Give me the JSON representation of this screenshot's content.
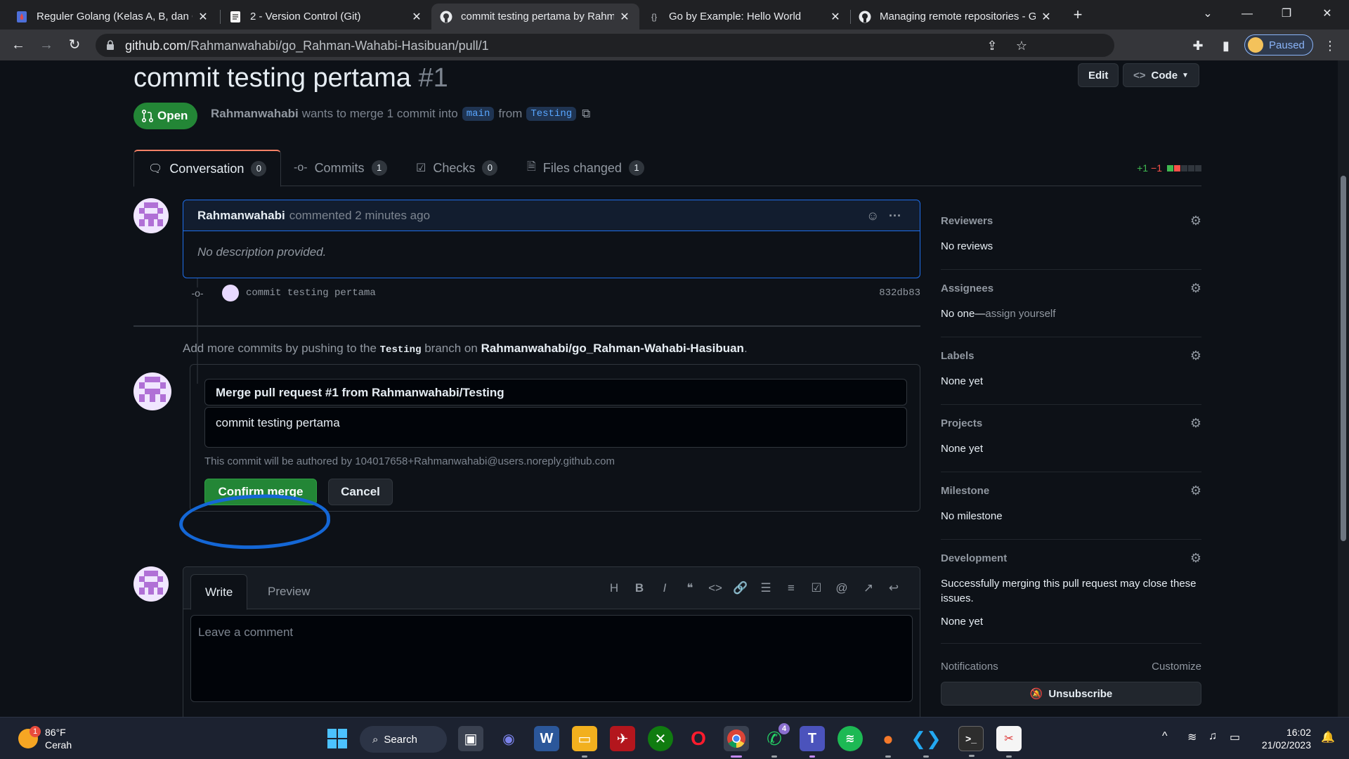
{
  "browser": {
    "tabs": [
      {
        "title": "Reguler Golang (Kelas A, B, dan C",
        "icon": "sheet-drop-icon",
        "active": false
      },
      {
        "title": "2 - Version Control (Git)",
        "icon": "notepad-icon",
        "active": false
      },
      {
        "title": "commit testing pertama by Rahm",
        "icon": "github-icon",
        "active": true
      },
      {
        "title": "Go by Example: Hello World",
        "icon": "braces-icon",
        "active": false
      },
      {
        "title": "Managing remote repositories - G",
        "icon": "github-icon",
        "active": false
      }
    ],
    "url_host": "github.com",
    "url_path": "/Rahmanwahabi/go_Rahman-Wahabi-Hasibuan/pull/1",
    "profile_status": "Paused"
  },
  "pr": {
    "title": "commit testing pertama",
    "number": "#1",
    "edit_label": "Edit",
    "code_label": "Code",
    "state": "Open",
    "author": "Rahmanwahabi",
    "merge_text": "wants to merge 1 commit into",
    "base_branch": "main",
    "from_text": "from",
    "head_branch": "Testing"
  },
  "tabs": [
    {
      "label": "Conversation",
      "count": "0"
    },
    {
      "label": "Commits",
      "count": "1"
    },
    {
      "label": "Checks",
      "count": "0"
    },
    {
      "label": "Files changed",
      "count": "1"
    }
  ],
  "diffstat": {
    "additions": "+1",
    "deletions": "−1"
  },
  "comment": {
    "author": "Rahmanwahabi",
    "meta": "commented 2 minutes ago",
    "body": "No description provided."
  },
  "commit": {
    "message": "commit testing pertama",
    "sha": "832db83"
  },
  "push_hint": {
    "prefix": "Add more commits by pushing to the",
    "branch": "Testing",
    "middle": "branch on",
    "repo": "Rahmanwahabi/go_Rahman-Wahabi-Hasibuan",
    "suffix": "."
  },
  "merge": {
    "title_value": "Merge pull request #1 from Rahmanwahabi/Testing",
    "message_value": "commit testing pertama",
    "author_note": "This commit will be authored by 104017658+Rahmanwahabi@users.noreply.github.com",
    "confirm_label": "Confirm merge",
    "cancel_label": "Cancel"
  },
  "composer": {
    "write_label": "Write",
    "preview_label": "Preview",
    "placeholder": "Leave a comment"
  },
  "sidebar": {
    "reviewers": {
      "label": "Reviewers",
      "value": "No reviews"
    },
    "assignees": {
      "label": "Assignees",
      "value": "No one—",
      "link": "assign yourself"
    },
    "labels": {
      "label": "Labels",
      "value": "None yet"
    },
    "projects": {
      "label": "Projects",
      "value": "None yet"
    },
    "milestone": {
      "label": "Milestone",
      "value": "No milestone"
    },
    "development": {
      "label": "Development",
      "note": "Successfully merging this pull request may close these issues.",
      "value": "None yet"
    },
    "notifications": {
      "label": "Notifications",
      "customize": "Customize",
      "unsubscribe": "Unsubscribe"
    }
  },
  "taskbar": {
    "weather_temp": "86°F",
    "weather_desc": "Cerah",
    "weather_badge": "1",
    "search_label": "Search",
    "whatsapp_badge": "4",
    "time": "16:02",
    "date": "21/02/2023"
  },
  "colors": {
    "accent_green": "#238636",
    "link_blue": "#58a6ff",
    "annotation_blue": "#1467d6"
  }
}
